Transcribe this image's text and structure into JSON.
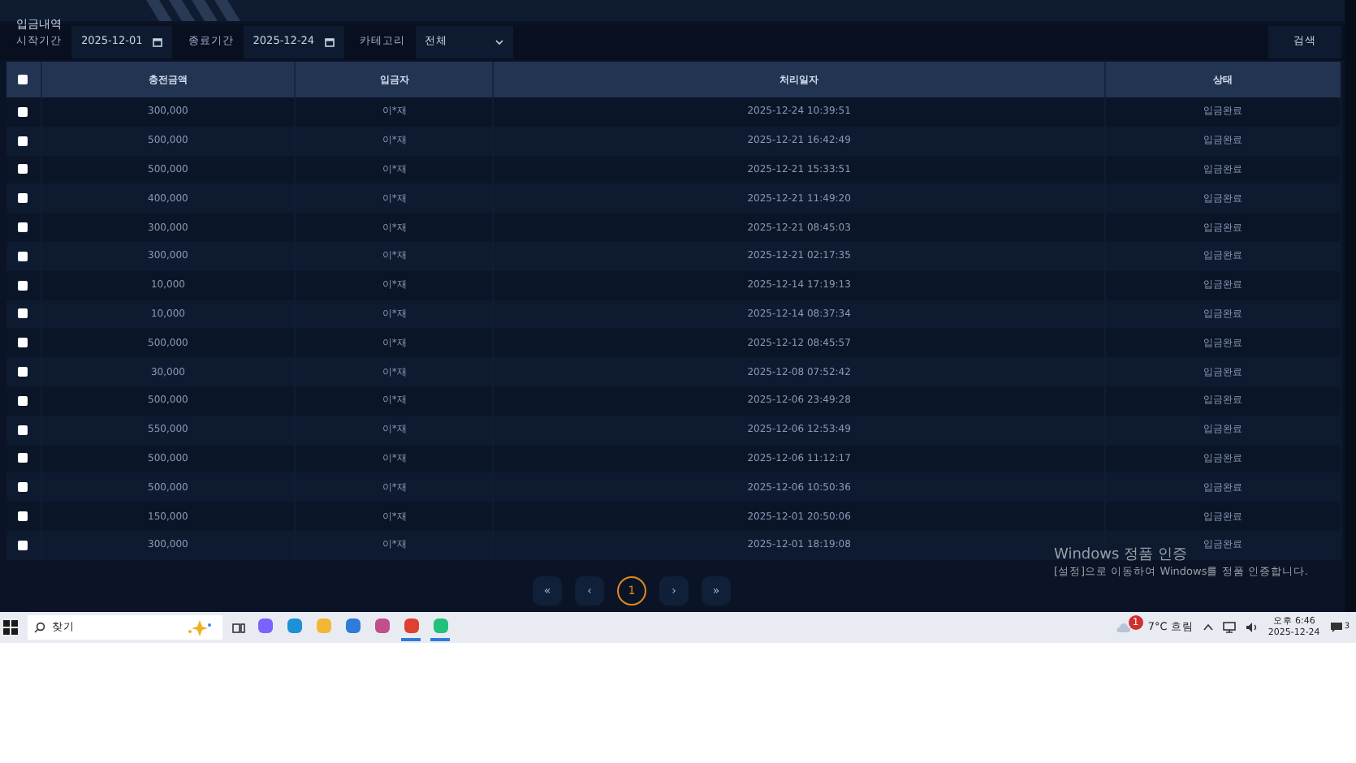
{
  "page_title": "입금내역",
  "filters": {
    "start_label": "시작기간",
    "start_value": "2025-12-01",
    "end_label": "종료기간",
    "end_value": "2025-12-24",
    "category_label": "카테고리",
    "category_value": "전체",
    "search_button": "검색"
  },
  "table": {
    "select_all_checked": false,
    "columns": [
      "충전금액",
      "입금자",
      "처리일자",
      "상태"
    ],
    "rows": [
      {
        "checked": false,
        "cells": [
          "300,000",
          "이*재",
          "2025-12-24 10:39:51",
          "입금완료"
        ]
      },
      {
        "checked": false,
        "cells": [
          "500,000",
          "이*재",
          "2025-12-21 16:42:49",
          "입금완료"
        ]
      },
      {
        "checked": false,
        "cells": [
          "500,000",
          "이*재",
          "2025-12-21 15:33:51",
          "입금완료"
        ]
      },
      {
        "checked": false,
        "cells": [
          "400,000",
          "이*재",
          "2025-12-21 11:49:20",
          "입금완료"
        ]
      },
      {
        "checked": false,
        "cells": [
          "300,000",
          "이*재",
          "2025-12-21 08:45:03",
          "입금완료"
        ]
      },
      {
        "checked": false,
        "cells": [
          "300,000",
          "이*재",
          "2025-12-21 02:17:35",
          "입금완료"
        ]
      },
      {
        "checked": false,
        "cells": [
          "10,000",
          "이*재",
          "2025-12-14 17:19:13",
          "입금완료"
        ]
      },
      {
        "checked": false,
        "cells": [
          "10,000",
          "이*재",
          "2025-12-14 08:37:34",
          "입금완료"
        ]
      },
      {
        "checked": false,
        "cells": [
          "500,000",
          "이*재",
          "2025-12-12 08:45:57",
          "입금완료"
        ]
      },
      {
        "checked": false,
        "cells": [
          "30,000",
          "이*재",
          "2025-12-08 07:52:42",
          "입금완료"
        ]
      },
      {
        "checked": false,
        "cells": [
          "500,000",
          "이*재",
          "2025-12-06 23:49:28",
          "입금완료"
        ]
      },
      {
        "checked": false,
        "cells": [
          "550,000",
          "이*재",
          "2025-12-06 12:53:49",
          "입금완료"
        ]
      },
      {
        "checked": false,
        "cells": [
          "500,000",
          "이*재",
          "2025-12-06 11:12:17",
          "입금완료"
        ]
      },
      {
        "checked": false,
        "cells": [
          "500,000",
          "이*재",
          "2025-12-06 10:50:36",
          "입금완료"
        ]
      },
      {
        "checked": false,
        "cells": [
          "150,000",
          "이*재",
          "2025-12-01 20:50:06",
          "입금완료"
        ]
      },
      {
        "checked": false,
        "cells": [
          "300,000",
          "이*재",
          "2025-12-01 18:19:08",
          "입금완료"
        ]
      }
    ]
  },
  "pagination": [
    {
      "label": "«",
      "selected": false
    },
    {
      "label": "‹",
      "selected": false
    },
    {
      "label": "1",
      "selected": true
    },
    {
      "label": "›",
      "selected": false
    },
    {
      "label": "»",
      "selected": false
    }
  ],
  "activation_notice": {
    "title": "Windows 정품 인증",
    "text": "[설정]으로 이동하여 Windows를 정품 인증합니다."
  },
  "taskbar": {
    "search_placeholder": "찾기",
    "apps": [
      {
        "color": "#7b61ff",
        "selected": false
      },
      {
        "color": "#1e90d6",
        "selected": false
      },
      {
        "color": "#f2b632",
        "selected": false
      },
      {
        "color": "#2f7bd8",
        "selected": false
      },
      {
        "color": "#c0508c",
        "selected": false
      },
      {
        "color": "#e0402f",
        "selected": true
      },
      {
        "color": "#22c07a",
        "selected": true
      }
    ],
    "weather": "7°C  흐림",
    "weather_badge": "1",
    "time": "오후 6:46",
    "date": "2025-12-24",
    "notification_count": "3"
  }
}
